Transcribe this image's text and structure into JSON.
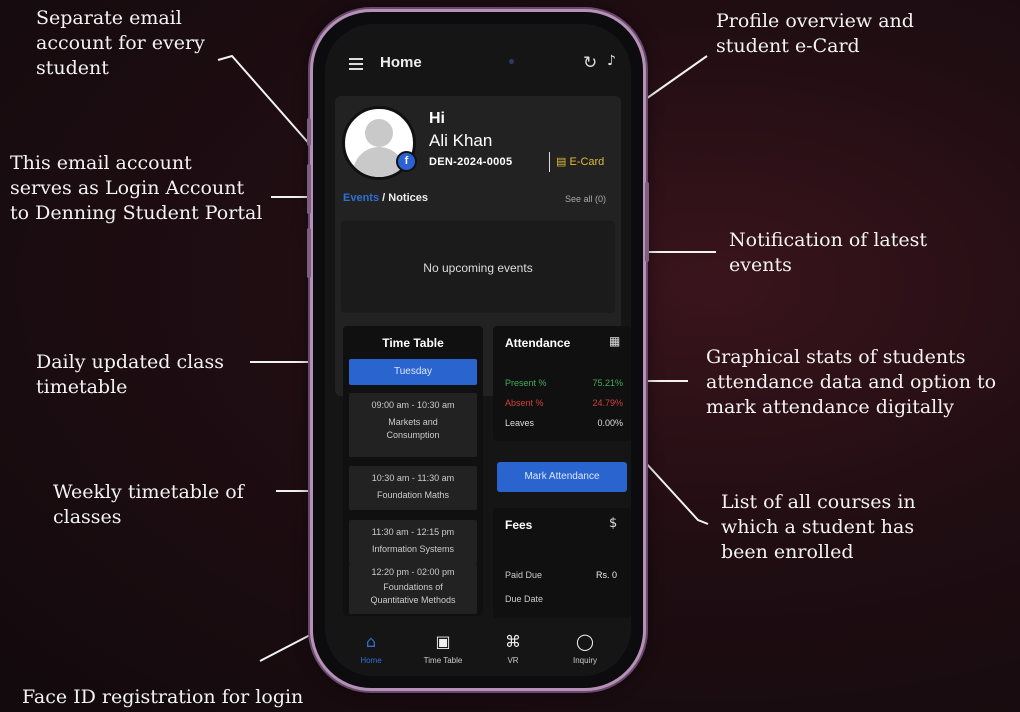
{
  "annotations": {
    "email_account": [
      "Separate email",
      "account for every",
      "student"
    ],
    "login_account": [
      "This  email account",
      "serves as Login Account",
      "to Denning Student Portal"
    ],
    "daily_timetable": [
      "Daily updated class",
      "timetable"
    ],
    "weekly_timetable": [
      "Weekly timetable of",
      "classes"
    ],
    "face_id": [
      "Face ID registration for login"
    ],
    "profile_overview": [
      "Profile overview and",
      "student e-Card"
    ],
    "notification": [
      "Notification of latest",
      "events"
    ],
    "attendance_stats": [
      "Graphical stats of students",
      "attendance data and option to",
      "mark attendance digitally"
    ],
    "courses_list": [
      "List of all courses in",
      "which a student has",
      "been enrolled"
    ]
  },
  "app": {
    "title": "Home",
    "icons": {
      "menu": "menu-icon",
      "refresh": "refresh-icon",
      "notifications": "bell-icon"
    }
  },
  "profile": {
    "greeting": "Hi",
    "name": "Ali Khan",
    "student_id": "DEN-2024-0005",
    "ecard_label": "E-Card"
  },
  "notices": {
    "events_tab": "Events",
    "notices_tab": "/ Notices",
    "see_all": "See all (0)",
    "empty_message": "No upcoming events"
  },
  "timetable": {
    "title": "Time Table",
    "day": "Tuesday",
    "slots": [
      {
        "time": "09:00 am - 10:30 am",
        "course": "Markets and Consumption"
      },
      {
        "time": "10:30 am - 11:30 am",
        "course": "Foundation Maths"
      },
      {
        "time": "11:30 am - 12:15 pm",
        "course": "Information Systems"
      },
      {
        "time": "12:20 pm - 02:00 pm",
        "course": "Foundations of Quantitative Methods"
      }
    ]
  },
  "attendance": {
    "title": "Attendance",
    "rows": [
      {
        "label": "Present %",
        "value": "75.21%",
        "color": "#3fae5a"
      },
      {
        "label": "Absent %",
        "value": "24.79%",
        "color": "#d0413a"
      },
      {
        "label": "Leaves",
        "value": "0.00%",
        "color": "#dddddd"
      }
    ],
    "mark_button": "Mark Attendance"
  },
  "fees": {
    "title": "Fees",
    "currency_icon": "$",
    "rows": [
      {
        "label": "Paid Due",
        "value": "Rs. 0"
      },
      {
        "label": "Due Date",
        "value": ""
      }
    ]
  },
  "nav": [
    {
      "label": "Home",
      "icon": "⌂"
    },
    {
      "label": "Time Table",
      "icon": "▣"
    },
    {
      "label": "VR",
      "icon": "⌘"
    },
    {
      "label": "Inquiry",
      "icon": "◯"
    }
  ],
  "colors": {
    "accent": "#2a64cf",
    "ecard": "#e2b83a",
    "phone_frame": "#b691b7"
  }
}
